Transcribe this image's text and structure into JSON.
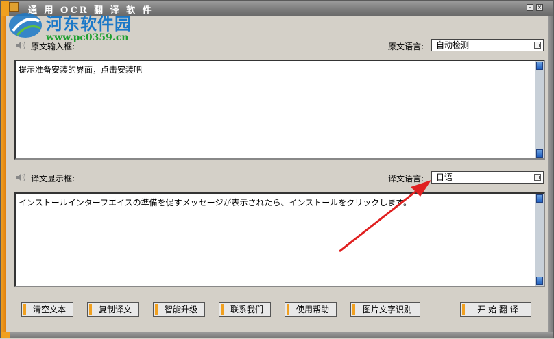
{
  "window": {
    "title": "通 用 OCR 翻 译 软 件"
  },
  "watermark": {
    "name": "河东软件园",
    "url": "www.pc0359.cn"
  },
  "source": {
    "label": "原文输入框:",
    "lang_label": "原文语言:",
    "lang_value": "自动检测",
    "text": "提示准备安装的界面，点击安装吧"
  },
  "target": {
    "label": "译文显示框:",
    "lang_label": "译文语言:",
    "lang_value": "日语",
    "text": "インストールインターフエイスの準備を促すメッセージが表示されたら、インストールをクリックします。"
  },
  "buttons": {
    "clear": "清空文本",
    "copy": "复制译文",
    "upgrade": "智能升级",
    "contact": "联系我们",
    "help": "使用帮助",
    "ocr": "图片文字识别",
    "translate": "开 始 翻 译"
  },
  "colors": {
    "accent": "#f0a020",
    "watermark_blue": "#1a78c8",
    "watermark_green": "#20a030",
    "annotation_arrow": "#e02020"
  }
}
